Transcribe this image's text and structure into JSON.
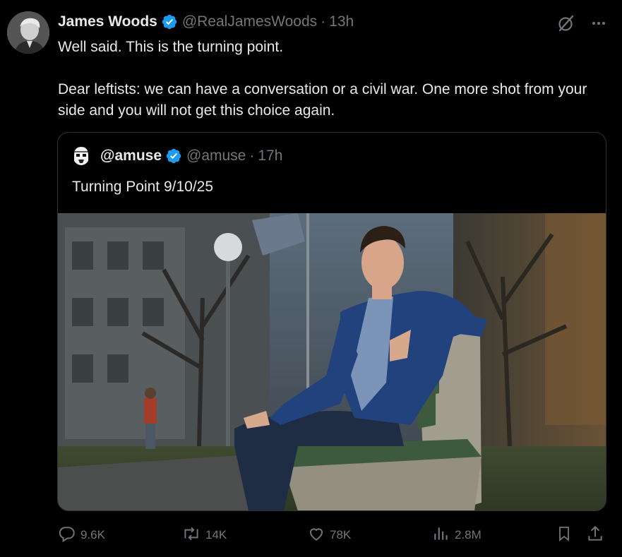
{
  "post": {
    "author_name": "James Woods",
    "author_handle": "@RealJamesWoods",
    "separator": "·",
    "time": "13h",
    "text": "Well said. This is the turning point.\n\nDear leftists: we can have a conversation or a civil war. One more shot from your side and you will not get this choice again."
  },
  "quote": {
    "author_name": "@amuse",
    "author_handle": "@amuse",
    "separator": "·",
    "time": "17h",
    "text": "Turning Point 9/10/25"
  },
  "actions": {
    "replies": "9.6K",
    "reposts": "14K",
    "likes": "78K",
    "views": "2.8M"
  },
  "colors": {
    "background": "#000000",
    "text": "#e7e9ea",
    "muted": "#71767b",
    "verified": "#1d9bf0",
    "border": "#2f3336"
  },
  "icons": [
    "verified-badge-icon",
    "grok-icon",
    "more-icon",
    "reply-icon",
    "repost-icon",
    "like-icon",
    "views-icon",
    "bookmark-icon",
    "share-icon"
  ]
}
